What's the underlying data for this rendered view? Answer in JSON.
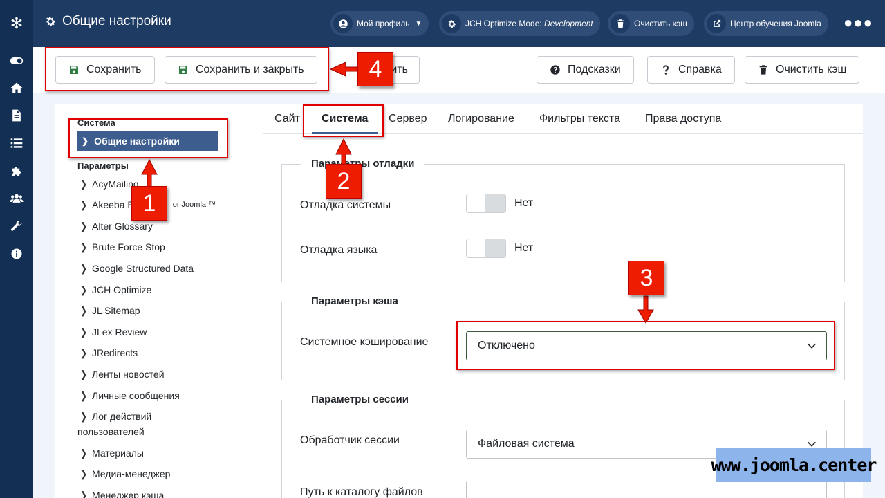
{
  "header": {
    "title": "Общие настройки",
    "profile_label": "Мой профиль",
    "jch_label": "JCH Optimize Mode:",
    "jch_mode": "Development",
    "clear_cache_label": "Очистить кэш",
    "learning_label": "Центр обучения Joomla",
    "more_label": "●●●"
  },
  "toolbar": {
    "save_label": "Сохранить",
    "save_close_label": "Сохранить и закрыть",
    "cancel_label_partial": "ить",
    "hints_label": "Подсказки",
    "help_label": "Справка",
    "clear_cache_label": "Очистить кэш"
  },
  "sidebar": {
    "system_heading": "Система",
    "active_item": "Общие настройки",
    "params_heading": "Параметры",
    "items": [
      "AcyMailing",
      "Akeeba B",
      "Alter Glossary",
      "Brute Force Stop",
      "Google Structured Data",
      "JCH Optimize",
      "JL Sitemap",
      "JLex Review",
      "JRedirects",
      "Ленты новостей",
      "Личные сообщения",
      "Лог действий",
      "Материалы",
      "Медиа-менеджер",
      "Менеджер кэша"
    ],
    "akeeba_suffix": "or Joomla!™",
    "log_line2": "пользователей"
  },
  "tabs": [
    "Сайт",
    "Система",
    "Сервер",
    "Логирование",
    "Фильтры текста",
    "Права доступа"
  ],
  "debug": {
    "legend": "Параметры отладки",
    "system_debug_label": "Отладка системы",
    "system_debug_value": "Нет",
    "lang_debug_label": "Отладка языка",
    "lang_debug_value": "Нет"
  },
  "cache": {
    "legend": "Параметры кэша",
    "label": "Системное кэширование",
    "value": "Отключено"
  },
  "session": {
    "legend": "Параметры сессии",
    "handler_label": "Обработчик сессии",
    "handler_value": "Файловая система",
    "path_label": "Путь к каталогу файлов"
  },
  "annotations": {
    "n1": "1",
    "n2": "2",
    "n3": "3",
    "n4": "4",
    "color": "#ee1c00"
  },
  "watermark": "www.joomla.center"
}
